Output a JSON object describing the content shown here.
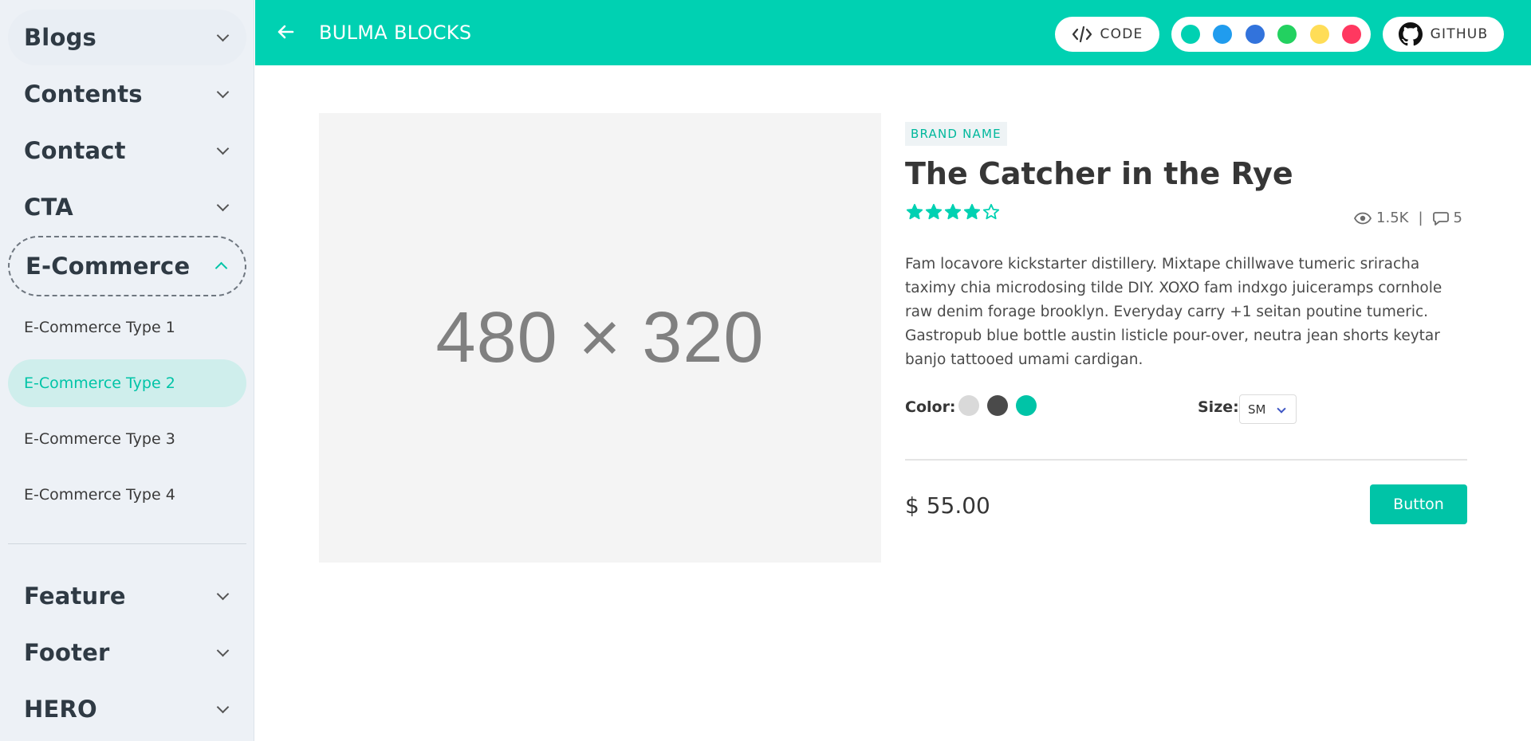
{
  "sidebar": {
    "categories_top": [
      {
        "label": "Blogs"
      },
      {
        "label": "Contents"
      },
      {
        "label": "Contact"
      },
      {
        "label": "CTA"
      }
    ],
    "open_category": {
      "label": "E-Commerce"
    },
    "sub_items": [
      {
        "label": "E-Commerce Type 1"
      },
      {
        "label": "E-Commerce Type 2"
      },
      {
        "label": "E-Commerce Type 3"
      },
      {
        "label": "E-Commerce Type 4"
      }
    ],
    "active_sub_item": "E-Commerce Type 2",
    "categories_bottom": [
      {
        "label": "Feature"
      },
      {
        "label": "Footer"
      },
      {
        "label": "HERO"
      }
    ]
  },
  "topbar": {
    "title": "BULMA BLOCKS",
    "code_label": "CODE",
    "github_label": "GITHUB",
    "theme_colors": [
      "#00d1b2",
      "#209cee",
      "#3273dc",
      "#23d160",
      "#ffdd57",
      "#ff3860"
    ]
  },
  "product": {
    "image_placeholder": "480 × 320",
    "brand": "BRAND NAME",
    "title": "The Catcher in the Rye",
    "rating": 4,
    "rating_max": 5,
    "views": "1.5K",
    "comments": "5",
    "description": "Fam locavore kickstarter distillery. Mixtape chillwave tumeric sriracha taximy chia microdosing tilde DIY. XOXO fam indxgo juiceramps cornhole raw denim forage brooklyn. Everyday carry +1 seitan poutine tumeric. Gastropub blue bottle austin listicle pour-over, neutra jean shorts keytar banjo tattooed umami cardigan.",
    "color_label": "Color:",
    "color_options": [
      "#d9d9d9",
      "#4a4a4a",
      "#00c4a7"
    ],
    "size_label": "Size:",
    "size_value": "SM",
    "price": "$ 55.00",
    "button_label": "Button"
  },
  "colors": {
    "accent": "#00d1b2",
    "sidebar_bg": "#edf1f6",
    "active_bg": "#cfeeec"
  }
}
